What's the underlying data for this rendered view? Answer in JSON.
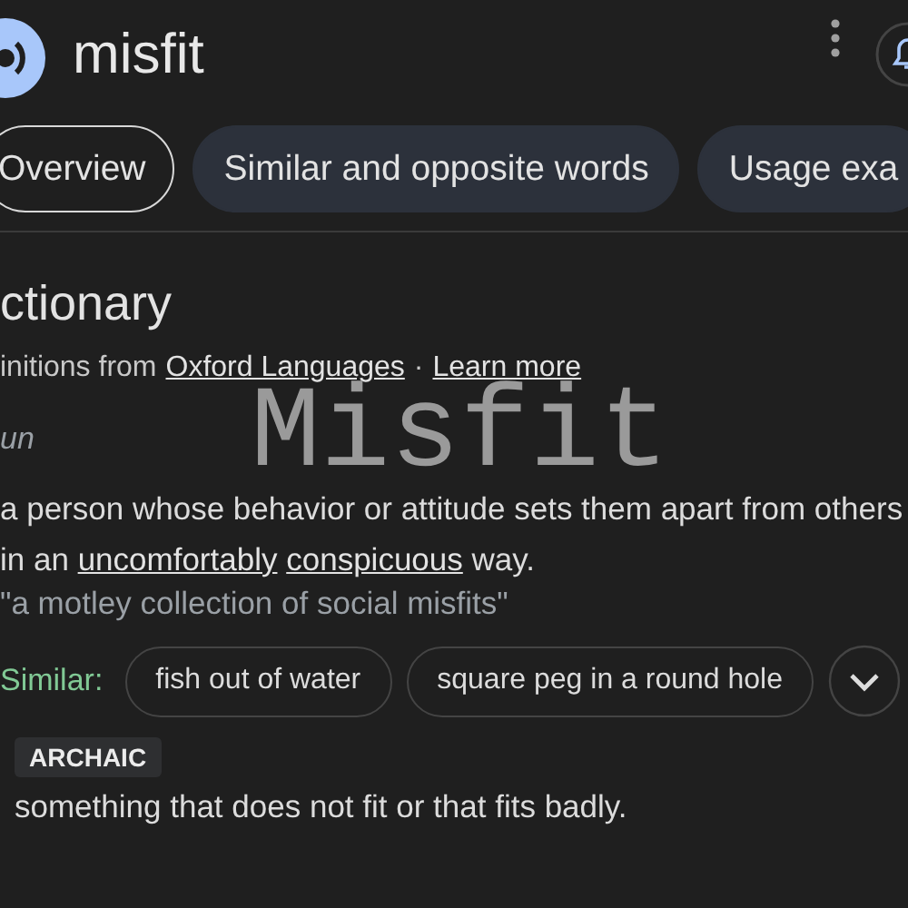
{
  "header": {
    "title": "misfit"
  },
  "tabs": [
    {
      "label": "Overview",
      "selected": true
    },
    {
      "label": "Similar and opposite words",
      "selected": false
    },
    {
      "label": "Usage exa",
      "selected": false
    }
  ],
  "dictionary": {
    "heading": "ctionary",
    "source_prefix": "initions from",
    "source_link": "Oxford Languages",
    "separator": "·",
    "learn_more": "Learn more",
    "part_of_speech": "un"
  },
  "sense_1": {
    "before": "a person whose behavior or attitude sets them apart from others in an",
    "link_1": "uncomfortably",
    "link_2": "conspicuous",
    "after": "way.",
    "example": "\"a motley collection of social misfits\"",
    "similar_label": "Similar:",
    "similar": [
      "fish out of water",
      "square peg in a round hole"
    ]
  },
  "sense_2": {
    "label": "ARCHAIC",
    "text": "something that does not fit or that fits badly."
  },
  "overlay_title": "Misfit"
}
